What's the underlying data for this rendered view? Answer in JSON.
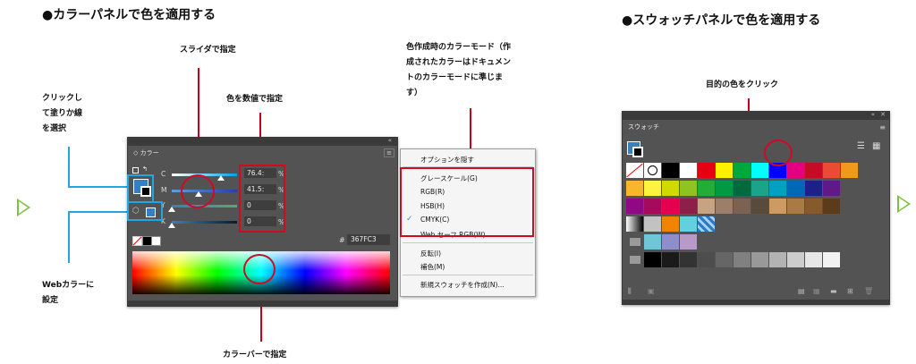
{
  "headings": {
    "color_panel": "●カラーパネルで色を適用する",
    "swatch_panel": "●スウォッチパネルで色を適用する"
  },
  "annotations": {
    "slider": "スライダで指定",
    "numeric": "色を数値で指定",
    "mode": [
      "色作成時のカラーモード（作",
      "成されたカラーはドキュメン",
      "トのカラーモードに準じま",
      "す）"
    ],
    "click_fill": [
      "クリックし",
      "て塗りか線",
      "を選択"
    ],
    "web": [
      "Webカラーに",
      "設定"
    ],
    "colorbar": "カラーバーで指定",
    "target": "目的の色をクリック"
  },
  "color_panel": {
    "tab_label": "カラー",
    "collapse_icon": "double-chevron-icon",
    "sliders": [
      {
        "label": "C",
        "value": "76.4:",
        "unit": "%",
        "level": 0.76
      },
      {
        "label": "M",
        "value": "41.5:",
        "unit": "%",
        "level": 0.41
      },
      {
        "label": "Y",
        "value": "0",
        "unit": "%",
        "level": 0.0
      },
      {
        "label": "K",
        "value": "0",
        "unit": "%",
        "level": 0.0
      }
    ],
    "hex_symbol": "#",
    "hex_value": "367FC3",
    "fill_color": "#367fc3"
  },
  "color_menu": {
    "items": [
      {
        "label": "オプションを隠す",
        "checked": false
      },
      {
        "label": "グレースケール(G)",
        "checked": false
      },
      {
        "label": "RGB(R)",
        "checked": false
      },
      {
        "label": "HSB(H)",
        "checked": false
      },
      {
        "label": "CMYK(C)",
        "checked": true
      },
      {
        "label": "Web セーフ RGB(W)",
        "checked": false
      },
      {
        "label": "反転(I)",
        "checked": false
      },
      {
        "label": "補色(M)",
        "checked": false
      },
      {
        "label": "新規スウォッチを作成(N)...",
        "checked": false
      }
    ]
  },
  "swatch_panel": {
    "tab_label": "スウォッチ",
    "rows": [
      [
        "none",
        "registration",
        "#000000",
        "#ffffff",
        "#e60012",
        "#fff100",
        "#00a73c",
        "#00ffff",
        "#0000ff",
        "#e4007f",
        "#c30d23",
        "#e94b35",
        "#f3981d"
      ],
      [
        "#f8b62d",
        "#fff33f",
        "#cfdb00",
        "#8fc31f",
        "#22ac38",
        "#009944",
        "#00693e",
        "#1ca48b",
        "#00a0c1",
        "#0068b7",
        "#1d2088",
        "#601986"
      ],
      [
        "#920783",
        "#a40b5d",
        "#e5004f",
        "#8e1f48",
        "#c7a382",
        "#9c7f6a",
        "#7a6350",
        "#594a3c",
        "#cb9b62",
        "#a97b44",
        "#865a2c",
        "#5c3a1a"
      ],
      [
        "#c2c2c2",
        "#f08300",
        "#62d0e1",
        "pattern"
      ],
      [
        "#6ec6d6",
        "#8c8fc9",
        "#b79ac8"
      ],
      [
        "#000000",
        "#1a1a1a",
        "#333333",
        "#4d4d4d",
        "#666666",
        "#808080",
        "#999999",
        "#b3b3b3",
        "#cccccc",
        "#e6e6e6",
        "#f2f2f2"
      ]
    ]
  },
  "accent": {
    "red": "#d10a22",
    "blue": "#1ea7e1",
    "green": "#7cc242"
  }
}
